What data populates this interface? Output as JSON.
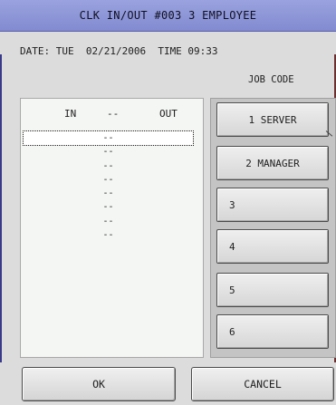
{
  "window": {
    "title": "CLK IN/OUT #003 3 EMPLOYEE"
  },
  "datetime": {
    "text": "DATE: TUE  02/21/2006  TIME 09:33"
  },
  "job_code": {
    "label": "JOB CODE",
    "buttons": [
      {
        "label": "1 SERVER"
      },
      {
        "label": "2 MANAGER"
      },
      {
        "label": "3"
      },
      {
        "label": "4"
      },
      {
        "label": "5"
      },
      {
        "label": "6"
      }
    ]
  },
  "punch_list": {
    "headers": {
      "in": "IN",
      "separator": "--",
      "out": "OUT"
    },
    "rows": [
      "--",
      "--",
      "--",
      "--",
      "--",
      "--",
      "--",
      "--"
    ]
  },
  "actions": {
    "ok": "OK",
    "cancel": "CANCEL"
  },
  "colors": {
    "title_bar": "#8c94d6",
    "panel_bg": "#f4f6f3",
    "frame_bg": "#dcdcdc"
  }
}
